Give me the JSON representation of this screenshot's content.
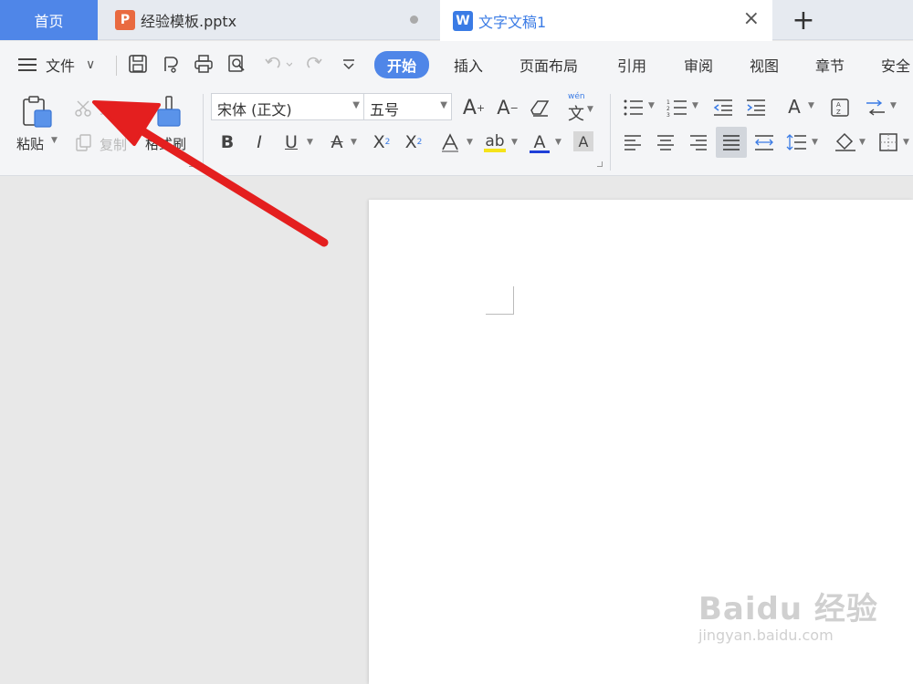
{
  "tabs": {
    "home": "首页",
    "pptx": "经验模板.pptx",
    "pptx_icon": "P",
    "doc": "文字文稿1",
    "doc_icon": "W",
    "close": "×",
    "new": "+"
  },
  "menu": {
    "file": "文件",
    "chevron": "∨",
    "items": [
      "开始",
      "插入",
      "页面布局",
      "引用",
      "审阅",
      "视图",
      "章节",
      "安全"
    ]
  },
  "ribbon": {
    "paste": "粘贴",
    "cut": "剪切",
    "copy": "复制",
    "format_painter": "格式刷",
    "font_name": "宋体 (正文)",
    "font_size": "五号",
    "pinyin_label": "wén",
    "bold": "B",
    "italic": "I",
    "underline": "U"
  },
  "watermark": {
    "main": "Baidu 经验",
    "url": "jingyan.baidu.com"
  },
  "colors": {
    "accent": "#4f86e8",
    "arrow": "#e41f1f",
    "pptx_icon": "#e96a40",
    "doc_icon": "#3a7be5"
  }
}
